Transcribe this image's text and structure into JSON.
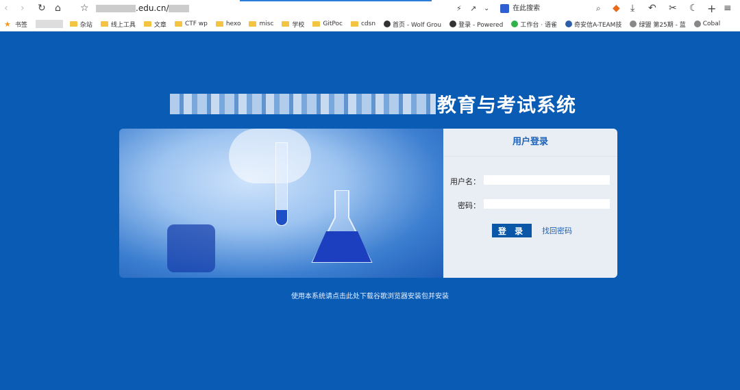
{
  "browser": {
    "url": ".edu.cn/",
    "search_placeholder": "在此搜索",
    "bookmarks_label": "书签",
    "bookmarks": [
      "杂站",
      "线上工具",
      "文章",
      "CTF wp",
      "hexo",
      "misc",
      "学校",
      "GitPoc",
      "cdsn"
    ],
    "site_bookmarks": [
      "首页 - Wolf Grou",
      "登录 - Powered",
      "工作台 · 语雀",
      "奇安信A-TEAM技",
      "绿盟 第25期 - 蓝",
      "Cobal"
    ]
  },
  "page": {
    "title_suffix": "教育与考试系统"
  },
  "login": {
    "header": "用户登录",
    "username_label": "用户名：",
    "password_label": "密码：",
    "login_button": "登 录",
    "forgot_link": "找回密码"
  },
  "footer": {
    "note": "使用本系统请点击此处下载谷歌浏览器安装包并安装"
  }
}
